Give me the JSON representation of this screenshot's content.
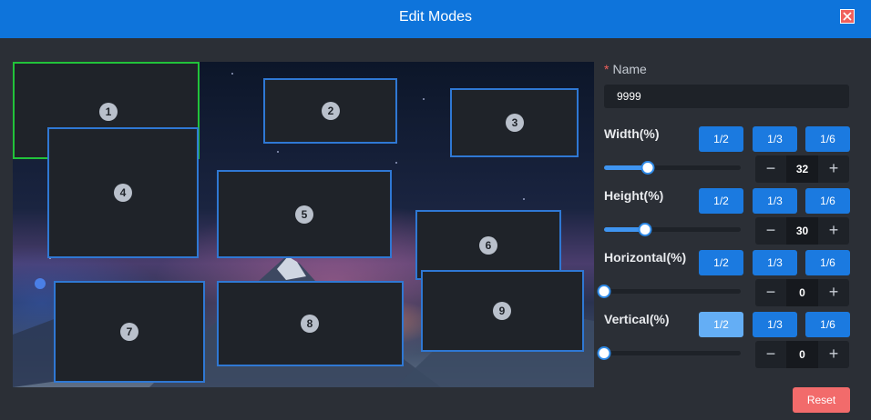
{
  "dialog": {
    "title": "Edit Modes"
  },
  "windows": [
    {
      "id": "1",
      "active": true
    },
    {
      "id": "2",
      "active": false
    },
    {
      "id": "3",
      "active": false
    },
    {
      "id": "4",
      "active": false
    },
    {
      "id": "5",
      "active": false
    },
    {
      "id": "6",
      "active": false
    },
    {
      "id": "7",
      "active": false
    },
    {
      "id": "8",
      "active": false
    },
    {
      "id": "9",
      "active": false
    }
  ],
  "form": {
    "name_label": "Name",
    "required_mark": "*",
    "name_value": "9999",
    "reset_label": "Reset",
    "width": {
      "label": "Width(%)",
      "fractions": [
        "1/2",
        "1/3",
        "1/6"
      ],
      "value": "32",
      "slider_percent": 32
    },
    "height": {
      "label": "Height(%)",
      "fractions": [
        "1/2",
        "1/3",
        "1/6"
      ],
      "value": "30",
      "slider_percent": 30
    },
    "horizontal": {
      "label": "Horizontal(%)",
      "fractions": [
        "1/2",
        "1/3",
        "1/6"
      ],
      "value": "0",
      "slider_percent": 0
    },
    "vertical": {
      "label": "Vertical(%)",
      "fractions": [
        "1/2",
        "1/3",
        "1/6"
      ],
      "value": "0",
      "slider_percent": 0,
      "hovered_fraction": "1/2"
    },
    "stepper_minus": "−",
    "stepper_plus": "+"
  },
  "colors": {
    "titlebar": "#0e74db",
    "accent_button": "#1b7ae0",
    "active_border": "#22c33a",
    "window_border": "#2f78d4",
    "reset": "#f26b6b"
  }
}
